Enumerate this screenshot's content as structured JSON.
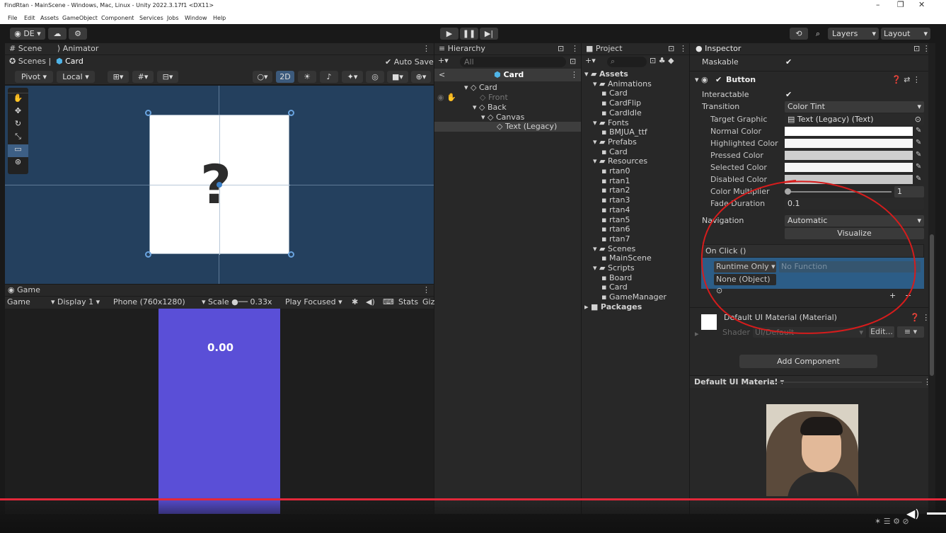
{
  "window": {
    "title": "FindRtan - MainScene - Windows, Mac, Linux - Unity 2022.3.17f1 <DX11>",
    "controls": [
      "–",
      "❐",
      "✕"
    ]
  },
  "menu": [
    "File",
    "Edit",
    "Assets",
    "GameObject",
    "Component",
    "Services",
    "Jobs",
    "Window",
    "Help"
  ],
  "toolbar": {
    "account": "DE",
    "layers_label": "Layers",
    "layout_label": "Layout"
  },
  "scene_panel": {
    "tabs": [
      "Scene",
      "Animator"
    ],
    "breadcrumb": [
      "Scenes",
      "Card"
    ],
    "auto_save": "Auto Save",
    "pivot": "Pivot",
    "local": "Local",
    "mode_2d": "2D",
    "card_symbol": "?"
  },
  "game_panel": {
    "tab": "Game",
    "view": "Game",
    "display": "Display 1",
    "resolution": "Phone (760x1280)",
    "scale_label": "Scale",
    "scale_value": "0.33x",
    "play_focused": "Play Focused",
    "stats": "Stats",
    "gizmos": "Giz",
    "timer_text": "0.00",
    "bg_color": "#5a4fd7"
  },
  "hierarchy": {
    "tab": "Hierarchy",
    "search_placeholder": "All",
    "root": "Card",
    "items": [
      {
        "label": "Card",
        "depth": 0
      },
      {
        "label": "Front",
        "depth": 1
      },
      {
        "label": "Back",
        "depth": 1
      },
      {
        "label": "Canvas",
        "depth": 2
      },
      {
        "label": "Text (Legacy)",
        "depth": 3
      }
    ]
  },
  "project": {
    "tab": "Project",
    "items": [
      {
        "label": "Assets",
        "depth": 0
      },
      {
        "label": "Animations",
        "depth": 1
      },
      {
        "label": "Card",
        "depth": 2
      },
      {
        "label": "CardFlip",
        "depth": 2
      },
      {
        "label": "CardIdle",
        "depth": 2
      },
      {
        "label": "Fonts",
        "depth": 1
      },
      {
        "label": "BMJUA_ttf",
        "depth": 2
      },
      {
        "label": "Prefabs",
        "depth": 1
      },
      {
        "label": "Card",
        "depth": 2
      },
      {
        "label": "Resources",
        "depth": 1
      },
      {
        "label": "rtan0",
        "depth": 2
      },
      {
        "label": "rtan1",
        "depth": 2
      },
      {
        "label": "rtan2",
        "depth": 2
      },
      {
        "label": "rtan3",
        "depth": 2
      },
      {
        "label": "rtan4",
        "depth": 2
      },
      {
        "label": "rtan5",
        "depth": 2
      },
      {
        "label": "rtan6",
        "depth": 2
      },
      {
        "label": "rtan7",
        "depth": 2
      },
      {
        "label": "Scenes",
        "depth": 1
      },
      {
        "label": "MainScene",
        "depth": 2
      },
      {
        "label": "Scripts",
        "depth": 1
      },
      {
        "label": "Board",
        "depth": 2
      },
      {
        "label": "Card",
        "depth": 2
      },
      {
        "label": "GameManager",
        "depth": 2
      },
      {
        "label": "Packages",
        "depth": 0
      }
    ]
  },
  "inspector": {
    "tab": "Inspector",
    "maskable": "Maskable",
    "component": "Button",
    "interactable": "Interactable",
    "transition": "Transition",
    "transition_value": "Color Tint",
    "target_graphic": "Target Graphic",
    "target_graphic_value": "Text (Legacy) (Text)",
    "colors": [
      "Normal Color",
      "Highlighted Color",
      "Pressed Color",
      "Selected Color",
      "Disabled Color"
    ],
    "color_multiplier": "Color Multiplier",
    "color_multiplier_value": "1",
    "fade_duration": "Fade Duration",
    "fade_duration_value": "0.1",
    "navigation": "Navigation",
    "navigation_value": "Automatic",
    "visualize": "Visualize",
    "on_click": "On Click ()",
    "runtime": "Runtime Only",
    "no_function": "No Function",
    "none_object": "None (Object)",
    "plus": "+",
    "minus": "−",
    "material": "Default UI Material (Material)",
    "shader_label": "Shader",
    "shader_value": "UI/Default",
    "edit": "Edit...",
    "add_component": "Add Component",
    "default_material": "Default UI Material"
  },
  "colors": {
    "scene_bg": "#24405e",
    "selection": "#2c5d87",
    "annotation": "#d61c1c",
    "progress": "#e3283a"
  }
}
